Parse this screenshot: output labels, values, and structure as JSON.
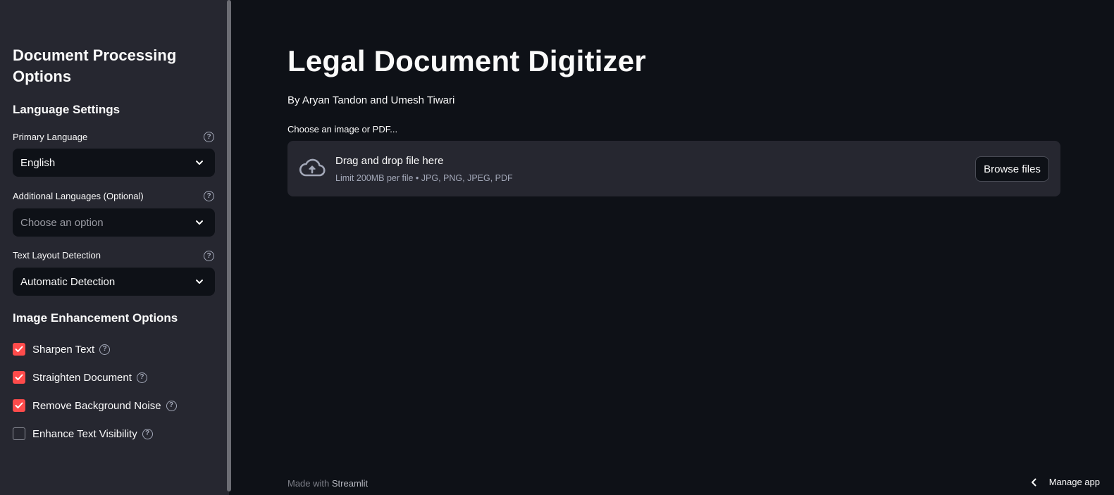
{
  "sidebar": {
    "title": "Document Processing Options",
    "language_section": "Language Settings",
    "primary_language": {
      "label": "Primary Language",
      "value": "English"
    },
    "additional_languages": {
      "label": "Additional Languages (Optional)",
      "placeholder": "Choose an option"
    },
    "layout_detection": {
      "label": "Text Layout Detection",
      "value": "Automatic Detection"
    },
    "enhancement_section": "Image Enhancement Options",
    "options": [
      {
        "label": "Sharpen Text",
        "checked": true
      },
      {
        "label": "Straighten Document",
        "checked": true
      },
      {
        "label": "Remove Background Noise",
        "checked": true
      },
      {
        "label": "Enhance Text Visibility",
        "checked": false
      }
    ],
    "help_glyph": "?"
  },
  "main": {
    "title": "Legal Document Digitizer",
    "authors": "By Aryan Tandon and Umesh Tiwari",
    "uploader": {
      "label": "Choose an image or PDF...",
      "drop_text": "Drag and drop file here",
      "limit_text": "Limit 200MB per file • JPG, PNG, JPEG, PDF",
      "browse_label": "Browse files",
      "icon": "cloud-upload-icon"
    }
  },
  "footer": {
    "made_with": "Made with",
    "brand": "Streamlit",
    "manage_app": "Manage app"
  },
  "colors": {
    "background": "#0e1117",
    "sidebar": "#262730",
    "accent": "#ff4b4b",
    "text": "#fafafa",
    "muted": "#a3a8b8"
  }
}
